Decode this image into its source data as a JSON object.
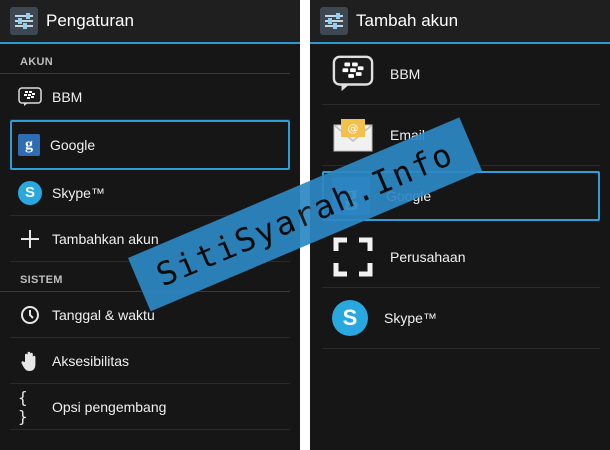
{
  "left": {
    "title": "Pengaturan",
    "sections": [
      {
        "header": "AKUN",
        "items": [
          {
            "label": "BBM",
            "icon": "bbm-icon"
          },
          {
            "label": "Google",
            "icon": "google-icon",
            "highlighted": true
          },
          {
            "label": "Skype™",
            "icon": "skype-icon"
          },
          {
            "label": "Tambahkan akun",
            "icon": "plus-icon"
          }
        ]
      },
      {
        "header": "SISTEM",
        "items": [
          {
            "label": "Tanggal & waktu",
            "icon": "clock-icon"
          },
          {
            "label": "Aksesibilitas",
            "icon": "hand-icon"
          },
          {
            "label": "Opsi pengembang",
            "icon": "braces-icon"
          }
        ]
      }
    ]
  },
  "right": {
    "title": "Tambah akun",
    "items": [
      {
        "label": "BBM",
        "icon": "bbm-icon"
      },
      {
        "label": "Email",
        "icon": "email-icon"
      },
      {
        "label": "Google",
        "icon": "google-icon",
        "highlighted": true
      },
      {
        "label": "Perusahaan",
        "icon": "corporate-icon"
      },
      {
        "label": "Skype™",
        "icon": "skype-icon"
      }
    ]
  },
  "watermark": "SitiSyarah.Info",
  "colors": {
    "accent": "#2e9ed6",
    "background": "#161616",
    "watermark": "#2c88c4"
  }
}
